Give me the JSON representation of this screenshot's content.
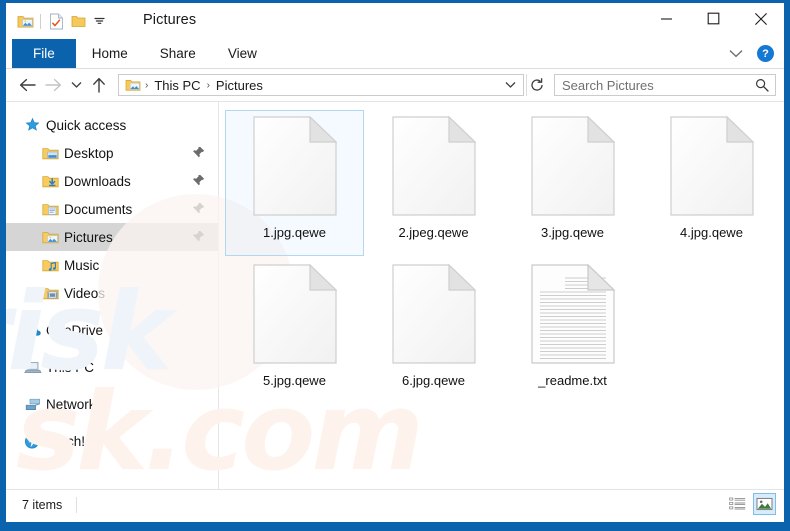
{
  "window": {
    "title": "Pictures",
    "accent_color": "#0b63ad",
    "quick_access_toolbar": [
      {
        "name": "pictures-folder-icon",
        "label": "Pictures properties"
      },
      {
        "name": "properties-icon",
        "label": "Properties"
      },
      {
        "name": "new-folder-icon",
        "label": "New folder"
      },
      {
        "name": "customize-chevron-icon",
        "label": "Customize Quick Access Toolbar"
      }
    ],
    "controls": {
      "minimize": "Minimize",
      "maximize": "Maximize",
      "close": "Close"
    }
  },
  "ribbon": {
    "tabs": [
      {
        "label": "File",
        "selected": true
      },
      {
        "label": "Home",
        "selected": false
      },
      {
        "label": "Share",
        "selected": false
      },
      {
        "label": "View",
        "selected": false
      }
    ],
    "collapse_label": "Minimize the Ribbon",
    "help_label": "?"
  },
  "address": {
    "back_label": "Back",
    "forward_label": "Forward",
    "recent_label": "Recent locations",
    "up_label": "Up",
    "breadcrumb": [
      "This PC",
      "Pictures"
    ],
    "separator": "›",
    "dropdown_label": "Previous locations",
    "refresh_label": "Refresh"
  },
  "search": {
    "placeholder": "Search Pictures",
    "icon": "search-icon"
  },
  "sidebar": {
    "items": [
      {
        "label": "Quick access",
        "icon": "star-icon",
        "indent": false,
        "pinned": false,
        "selected": false,
        "gap_before": false
      },
      {
        "label": "Desktop",
        "icon": "desktop-folder-icon",
        "indent": true,
        "pinned": true,
        "selected": false,
        "gap_before": false
      },
      {
        "label": "Downloads",
        "icon": "downloads-folder-icon",
        "indent": true,
        "pinned": true,
        "selected": false,
        "gap_before": false
      },
      {
        "label": "Documents",
        "icon": "documents-folder-icon",
        "indent": true,
        "pinned": true,
        "selected": false,
        "gap_before": false
      },
      {
        "label": "Pictures",
        "icon": "pictures-folder-icon",
        "indent": true,
        "pinned": true,
        "selected": true,
        "gap_before": false
      },
      {
        "label": "Music",
        "icon": "music-folder-icon",
        "indent": true,
        "pinned": false,
        "selected": false,
        "gap_before": false
      },
      {
        "label": "Videos",
        "icon": "videos-folder-icon",
        "indent": true,
        "pinned": false,
        "selected": false,
        "gap_before": false
      },
      {
        "label": "OneDrive",
        "icon": "onedrive-cloud-icon",
        "indent": false,
        "pinned": false,
        "selected": false,
        "gap_before": true
      },
      {
        "label": "This PC",
        "icon": "this-pc-icon",
        "indent": false,
        "pinned": false,
        "selected": false,
        "gap_before": true
      },
      {
        "label": "Network",
        "icon": "network-icon",
        "indent": false,
        "pinned": false,
        "selected": false,
        "gap_before": true
      },
      {
        "label": "Catch!",
        "icon": "catch-icon",
        "indent": false,
        "pinned": false,
        "selected": false,
        "gap_before": true
      }
    ]
  },
  "files": [
    {
      "name": "1.jpg.qewe",
      "icon": "blank-file-icon",
      "selected": true
    },
    {
      "name": "2.jpeg.qewe",
      "icon": "blank-file-icon",
      "selected": false
    },
    {
      "name": "3.jpg.qewe",
      "icon": "blank-file-icon",
      "selected": false
    },
    {
      "name": "4.jpg.qewe",
      "icon": "blank-file-icon",
      "selected": false
    },
    {
      "name": "5.jpg.qewe",
      "icon": "blank-file-icon",
      "selected": false
    },
    {
      "name": "6.jpg.qewe",
      "icon": "blank-file-icon",
      "selected": false
    },
    {
      "name": "_readme.txt",
      "icon": "text-file-icon",
      "selected": false
    }
  ],
  "status": {
    "items_text": "7 items",
    "views": [
      {
        "name": "details-view",
        "label": "Details",
        "active": false
      },
      {
        "name": "large-icons-view",
        "label": "Large icons",
        "active": true
      }
    ]
  },
  "watermark": {
    "blue_text": "risk",
    "peach_text": "sk.com"
  }
}
